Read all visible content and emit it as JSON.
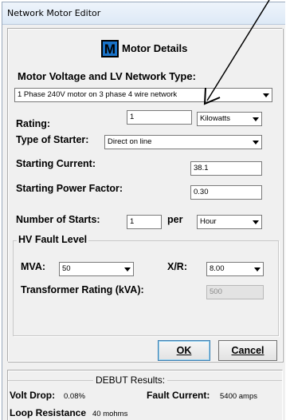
{
  "window": {
    "title": "Network Motor Editor",
    "close_glyph": "✕"
  },
  "header": {
    "logo_letter": "M",
    "title": "Motor Details"
  },
  "voltage": {
    "label": "Motor Voltage and LV Network Type:",
    "value": "1 Phase 240V motor on 3 phase 4 wire network"
  },
  "rating": {
    "label": "Rating:",
    "value": "1",
    "unit": "Kilowatts"
  },
  "starter": {
    "label": "Type of Starter:",
    "value": "Direct on line"
  },
  "starting_current": {
    "label": "Starting Current:",
    "value": "38.1"
  },
  "starting_pf": {
    "label": "Starting Power Factor:",
    "value": "0.30"
  },
  "starts": {
    "label": "Number of Starts:",
    "value": "1",
    "per_label": "per",
    "period": "Hour"
  },
  "hv_fault": {
    "group_title": "HV Fault Level",
    "mva_label": "MVA:",
    "mva_value": "50",
    "xr_label": "X/R:",
    "xr_value": "8.00",
    "transformer_label": "Transformer Rating (kVA):",
    "transformer_value": "500"
  },
  "buttons": {
    "ok": "OK",
    "cancel": "Cancel"
  },
  "results": {
    "title": "DEBUT Results:",
    "volt_drop_label": "Volt Drop:",
    "volt_drop_value": "0.08%",
    "fault_current_label": "Fault Current:",
    "fault_current_value": "5400 amps",
    "loop_resistance_label": "Loop Resistance",
    "loop_resistance_value": "40 mohms"
  },
  "colors": {
    "logo_blue": "#1a73c8",
    "annotation_arrow": "#000000"
  }
}
